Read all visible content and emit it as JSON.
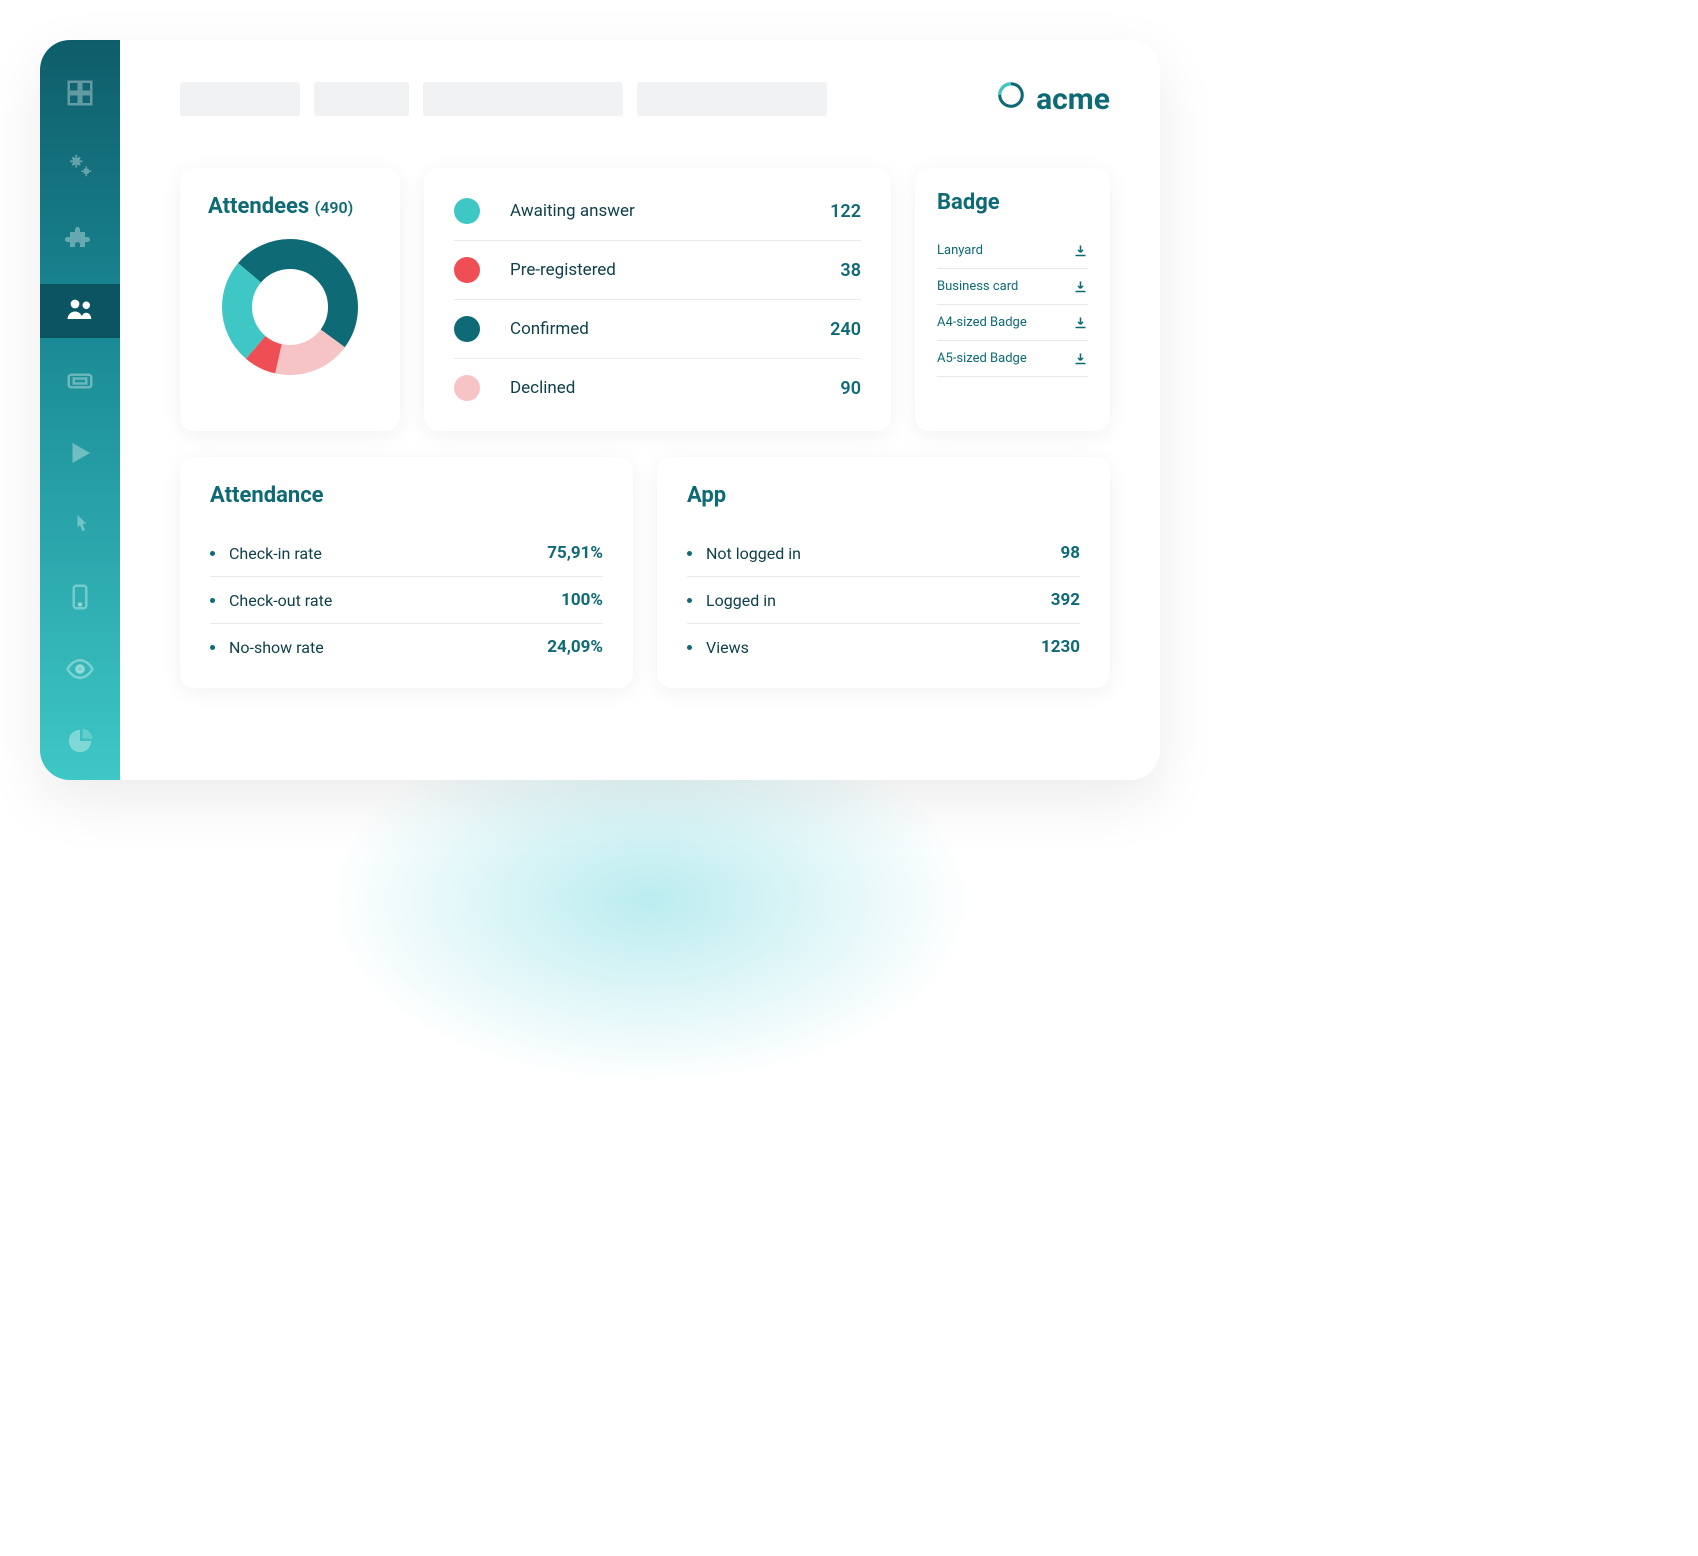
{
  "brand": "acme",
  "colors": {
    "awaiting": "#3ec7c5",
    "preregistered": "#ef4e54",
    "confirmed": "#0e6a74",
    "declined": "#f7c4c6"
  },
  "attendees": {
    "title": "Attendees",
    "count": "(490)",
    "statuses": [
      {
        "label": "Awaiting answer",
        "value": "122",
        "color": "#3ec7c5"
      },
      {
        "label": "Pre-registered",
        "value": "38",
        "color": "#ef4e54"
      },
      {
        "label": "Confirmed",
        "value": "240",
        "color": "#0e6a74"
      },
      {
        "label": "Declined",
        "value": "90",
        "color": "#f7c4c6"
      }
    ]
  },
  "badge": {
    "title": "Badge",
    "items": [
      {
        "label": "Lanyard"
      },
      {
        "label": "Business card"
      },
      {
        "label": "A4-sized Badge"
      },
      {
        "label": "A5-sized Badge"
      }
    ]
  },
  "attendance": {
    "title": "Attendance",
    "metrics": [
      {
        "label": "Check-in rate",
        "value": "75,91%"
      },
      {
        "label": "Check-out rate",
        "value": "100%"
      },
      {
        "label": "No-show rate",
        "value": "24,09%"
      }
    ]
  },
  "app": {
    "title": "App",
    "metrics": [
      {
        "label": "Not logged in",
        "value": "98"
      },
      {
        "label": "Logged in",
        "value": "392"
      },
      {
        "label": "Views",
        "value": "1230"
      }
    ]
  },
  "chart_data": {
    "type": "pie",
    "title": "Attendees (490)",
    "categories": [
      "Awaiting answer",
      "Pre-registered",
      "Confirmed",
      "Declined"
    ],
    "values": [
      122,
      38,
      240,
      90
    ]
  }
}
